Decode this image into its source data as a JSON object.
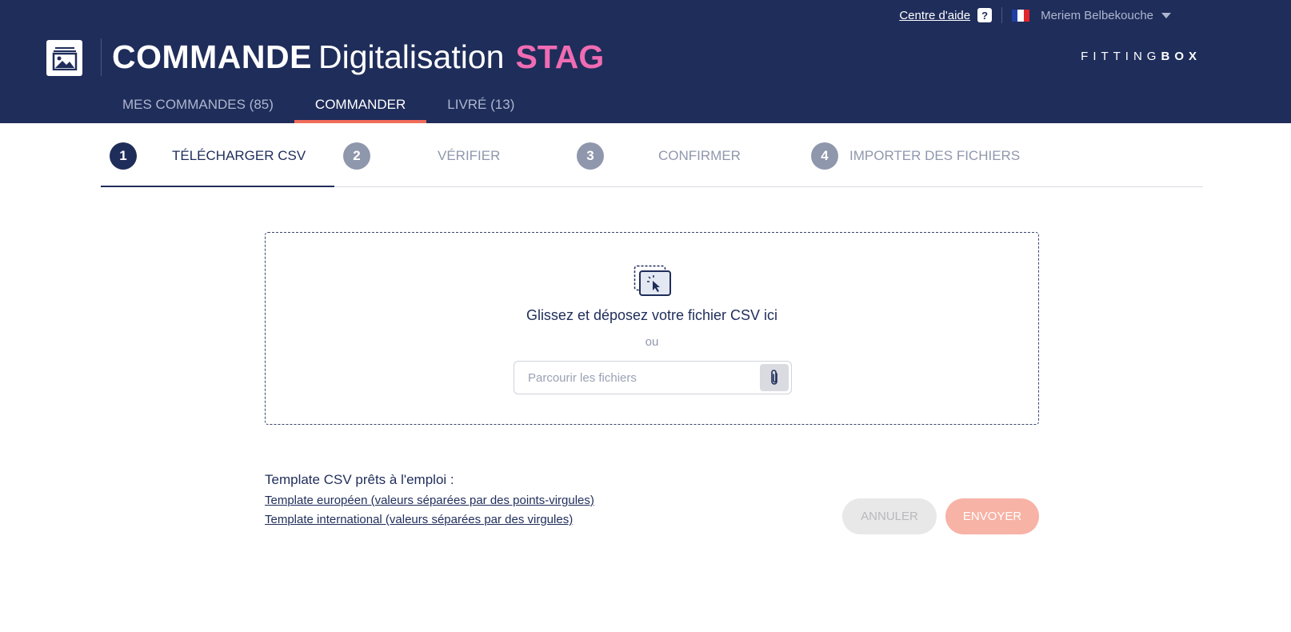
{
  "topbar": {
    "help_label": "Centre d'aide",
    "help_badge": "?",
    "language_flag": "fr-flag-icon",
    "user_name": "Meriem Belbekouche"
  },
  "header": {
    "title_part1": "COMMANDE",
    "title_part2": "Digitalisation",
    "environment": "STAG",
    "brand_part1": "FITTING",
    "brand_part2": "BOX"
  },
  "nav": {
    "tabs": [
      {
        "label": "MES COMMANDES (85)",
        "active": false
      },
      {
        "label": "COMMANDER",
        "active": true
      },
      {
        "label": "LIVRÉ (13)",
        "active": false
      }
    ]
  },
  "steps": [
    {
      "number": "1",
      "label": "TÉLÉCHARGER CSV",
      "active": true
    },
    {
      "number": "2",
      "label": "VÉRIFIER",
      "active": false
    },
    {
      "number": "3",
      "label": "CONFIRMER",
      "active": false
    },
    {
      "number": "4",
      "label": "IMPORTER DES FICHIERS",
      "active": false
    }
  ],
  "dropzone": {
    "title": "Glissez et déposez votre fichier CSV ici",
    "or_text": "ou",
    "input_placeholder": "Parcourir les fichiers"
  },
  "templates": {
    "title": "Template CSV prêts à l'emploi :",
    "links": [
      "Template européen (valeurs séparées par des points-virgules)",
      "Template international (valeurs séparées par des virgules)"
    ]
  },
  "actions": {
    "cancel_label": "ANNULER",
    "send_label": "ENVOYER"
  },
  "colors": {
    "header_bg": "#1f2d5a",
    "environment": "#ef6cb3",
    "active_tab_underline": "#ef6b5a",
    "send_button": "#f7b3a6"
  }
}
